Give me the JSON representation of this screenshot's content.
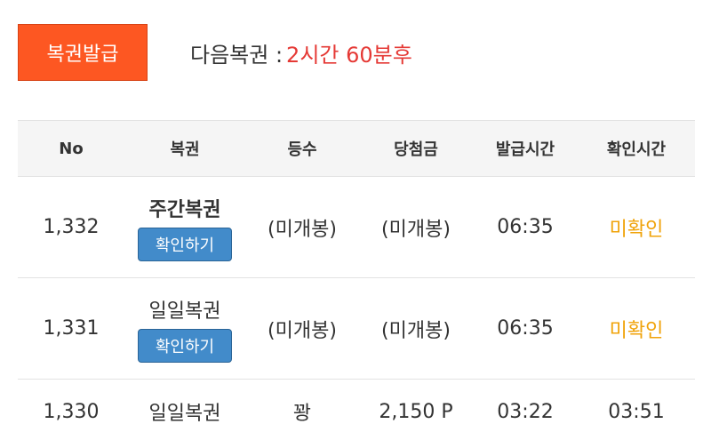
{
  "header": {
    "issue_button_label": "복권발급",
    "next_label": "다음복권 :",
    "next_value": "2시간 60분후"
  },
  "table": {
    "columns": [
      "No",
      "복권",
      "등수",
      "당첨금",
      "발급시간",
      "확인시간"
    ],
    "rows": [
      {
        "no": "1,332",
        "type": "주간복권",
        "rank": "(미개봉)",
        "prize": "(미개봉)",
        "issue_time": "06:35",
        "check_time": "미확인",
        "action_label": "확인하기"
      },
      {
        "no": "1,331",
        "type": "일일복권",
        "rank": "(미개봉)",
        "prize": "(미개봉)",
        "issue_time": "06:35",
        "check_time": "미확인",
        "action_label": "확인하기"
      },
      {
        "no": "1,330",
        "type": "일일복권",
        "rank": "꽝",
        "prize": "2,150 P",
        "issue_time": "03:22",
        "check_time": "03:51"
      }
    ]
  },
  "colors": {
    "issue_button": "#fd5722",
    "next_value": "#e53935",
    "confirm_button": "#428bca",
    "unconfirmed": "#f0a30a"
  }
}
